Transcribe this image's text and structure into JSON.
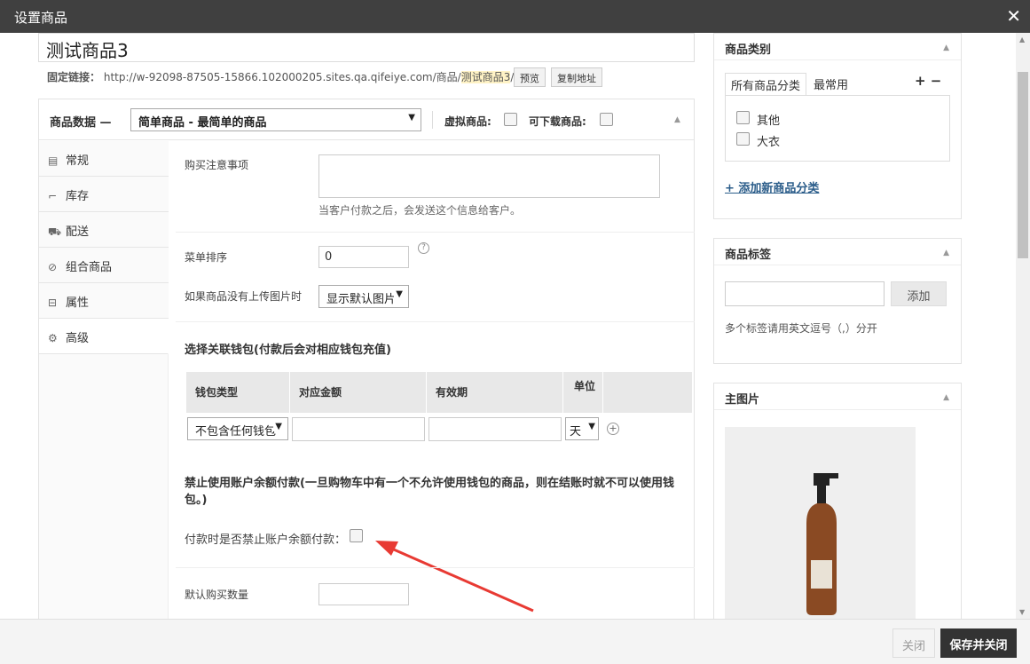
{
  "window": {
    "title": "设置商品",
    "close_glyph": "✕"
  },
  "product": {
    "name": "测试商品3"
  },
  "permalink": {
    "label": "固定链接：",
    "url_prefix": "http://w-92098-87505-15866.102000205.sites.qa.qifeiye.com/商品/",
    "slug": "测试商品3",
    "url_suffix": "/",
    "preview_label": "预览",
    "copy_label": "复制地址"
  },
  "product_data": {
    "title": "商品数据 —",
    "type_value": "简单商品 - 最简单的商品",
    "virtual_label": "虚拟商品:",
    "downloadable_label": "可下载商品:"
  },
  "tabs": [
    {
      "label": "常规",
      "icon": "grid-icon"
    },
    {
      "label": "库存",
      "icon": "chart-icon"
    },
    {
      "label": "配送",
      "icon": "truck-icon"
    },
    {
      "label": "组合商品",
      "icon": "link-icon"
    },
    {
      "label": "属性",
      "icon": "list-icon"
    },
    {
      "label": "高级",
      "icon": "gear-icon"
    }
  ],
  "advanced": {
    "purchase_note_label": "购买注意事项",
    "purchase_note_hint": "当客户付款之后，会发送这个信息给客户。",
    "menu_order_label": "菜单排序",
    "menu_order_value": "0",
    "no_image_label": "如果商品没有上传图片时",
    "no_image_value": "显示默认图片",
    "wallet_section_title": "选择关联钱包(付款后会对相应钱包充值)",
    "wallet_headers": [
      "钱包类型",
      "对应金额",
      "有效期",
      "单位"
    ],
    "wallet_type_value": "不包含任何钱包",
    "wallet_unit_value": "天",
    "balance_title": "禁止使用账户余额付款(一旦购物车中有一个不允许使用钱包的商品，则在结账时就不可以使用钱包。)",
    "balance_label": "付款时是否禁止账户余额付款：",
    "default_qty_label": "默认购买数量"
  },
  "categories": {
    "title": "商品类别",
    "tab_all": "所有商品分类",
    "tab_common": "最常用",
    "items": [
      "其他",
      "大衣"
    ],
    "add_link": "+ 添加新商品分类"
  },
  "tags": {
    "title": "商品标签",
    "add_button": "添加",
    "hint": "多个标签请用英文逗号（,）分开"
  },
  "main_image": {
    "title": "主图片"
  },
  "footer": {
    "close_label": "关闭",
    "save_label": "保存并关闭"
  }
}
